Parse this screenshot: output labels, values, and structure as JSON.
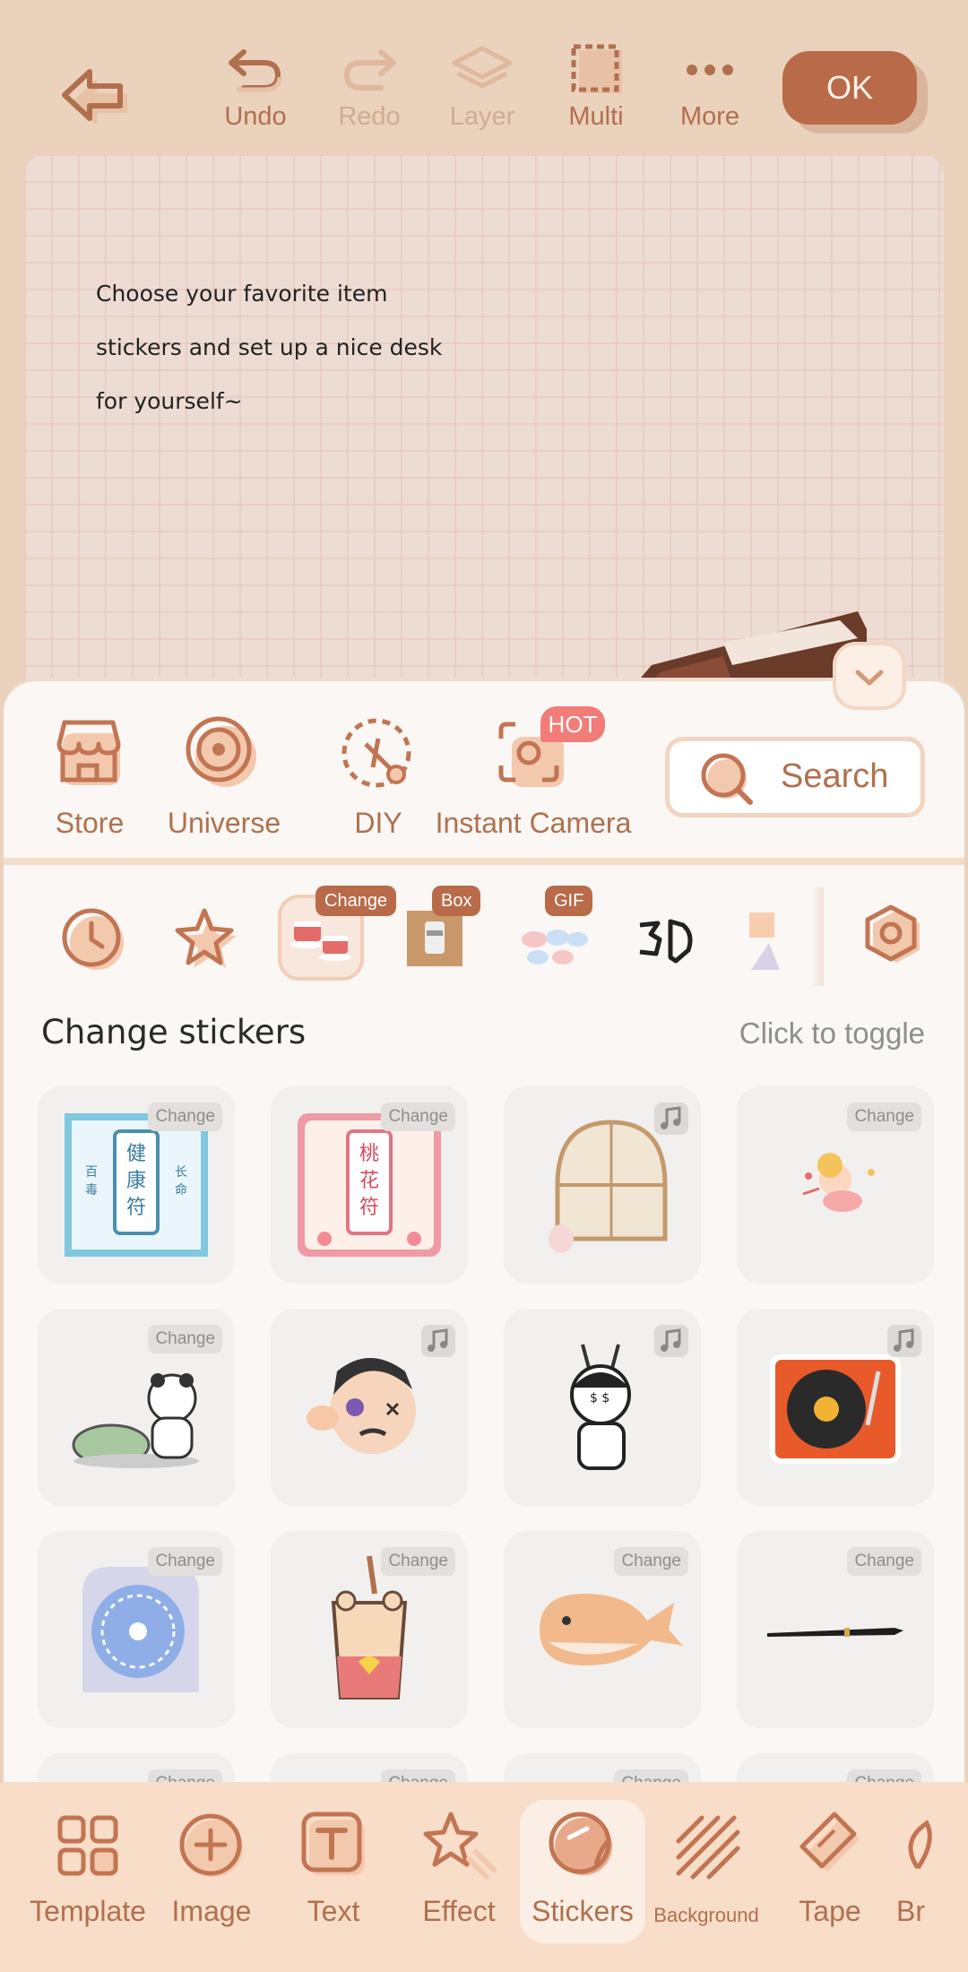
{
  "toolbar": {
    "undo": "Undo",
    "redo": "Redo",
    "layer": "Layer",
    "multi": "Multi",
    "more": "More",
    "ok": "OK"
  },
  "canvas": {
    "line1": "Choose your favorite item",
    "line2": "stickers and set up a nice desk",
    "line3": "for yourself~"
  },
  "quick_actions": {
    "store": "Store",
    "universe": "Universe",
    "diy": "DIY",
    "instant_camera": "Instant Camera",
    "hot_badge": "HOT",
    "search": "Search"
  },
  "categories": {
    "change_badge": "Change",
    "box_badge": "Box",
    "gif_badge": "GIF"
  },
  "section": {
    "title": "Change stickers",
    "hint": "Click to toggle"
  },
  "stickers": {
    "change_tag": "Change"
  },
  "bottom_nav": {
    "template": "Template",
    "image": "Image",
    "text": "Text",
    "effect": "Effect",
    "stickers": "Stickers",
    "background": "Background",
    "tape": "Tape",
    "brush": "Br"
  },
  "colors": {
    "accent": "#b96a49",
    "panel": "#faf7f4",
    "topbar": "#ead2bd",
    "hot": "#f27c78"
  }
}
